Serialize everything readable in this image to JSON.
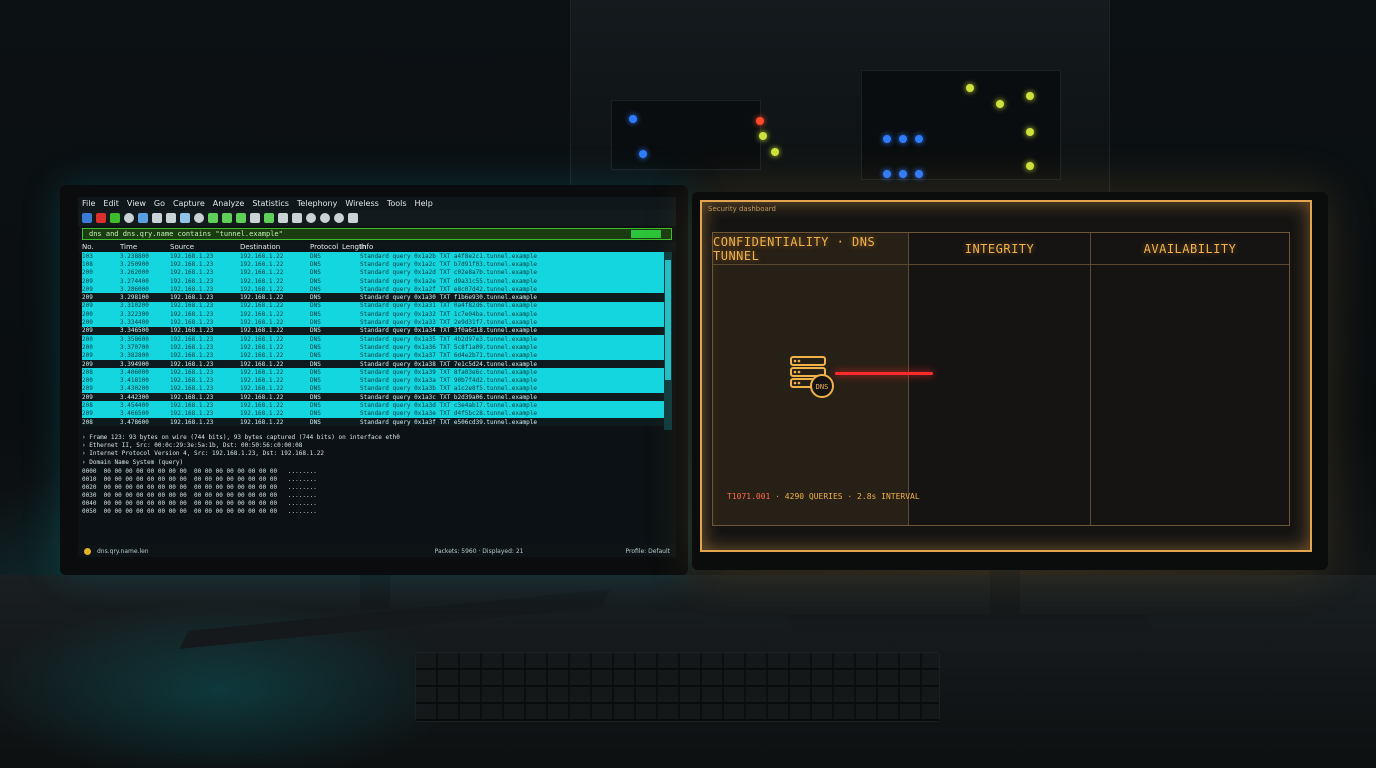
{
  "left_monitor": {
    "menu": [
      "File",
      "Edit",
      "View",
      "Go",
      "Capture",
      "Analyze",
      "Statistics",
      "Telephony",
      "Wireless",
      "Tools",
      "Help"
    ],
    "filter_text": "dns and dns.qry.name contains \"tunnel.example\"",
    "columns": [
      "No.",
      "Time",
      "Source",
      "Destination",
      "Protocol",
      "Length",
      "Info"
    ],
    "packets": [
      {
        "no": "103",
        "time": "3.238800",
        "src": "192.168.1.23",
        "dst": "192.168.1.22",
        "proto": "DNS",
        "info": "Standard query 0x1a2b TXT a4f8e2c1.tunnel.example"
      },
      {
        "no": "108",
        "time": "3.250900",
        "src": "192.168.1.23",
        "dst": "192.168.1.22",
        "proto": "DNS",
        "info": "Standard query 0x1a2c TXT b7d91f03.tunnel.example"
      },
      {
        "no": "200",
        "time": "3.262000",
        "src": "192.168.1.23",
        "dst": "192.168.1.22",
        "proto": "DNS",
        "info": "Standard query 0x1a2d TXT c02e8a7b.tunnel.example"
      },
      {
        "no": "209",
        "time": "3.274400",
        "src": "192.168.1.23",
        "dst": "192.168.1.22",
        "proto": "DNS",
        "info": "Standard query 0x1a2e TXT d9a31c55.tunnel.example"
      },
      {
        "no": "209",
        "time": "3.286000",
        "src": "192.168.1.23",
        "dst": "192.168.1.22",
        "proto": "DNS",
        "info": "Standard query 0x1a2f TXT e8c07d42.tunnel.example"
      },
      {
        "no": "209",
        "time": "3.298100",
        "src": "192.168.1.23",
        "dst": "192.168.1.22",
        "proto": "DNS",
        "info": "Standard query 0x1a30 TXT f1b6e930.tunnel.example"
      },
      {
        "no": "209",
        "time": "3.310200",
        "src": "192.168.1.23",
        "dst": "192.168.1.22",
        "proto": "DNS",
        "info": "Standard query 0x1a31 TXT 0a4f82d6.tunnel.example"
      },
      {
        "no": "200",
        "time": "3.322300",
        "src": "192.168.1.23",
        "dst": "192.168.1.22",
        "proto": "DNS",
        "info": "Standard query 0x1a32 TXT 1c7e04ba.tunnel.example"
      },
      {
        "no": "200",
        "time": "3.334400",
        "src": "192.168.1.23",
        "dst": "192.168.1.22",
        "proto": "DNS",
        "info": "Standard query 0x1a33 TXT 2e9d31f7.tunnel.example"
      },
      {
        "no": "209",
        "time": "3.346500",
        "src": "192.168.1.23",
        "dst": "192.168.1.22",
        "proto": "DNS",
        "info": "Standard query 0x1a34 TXT 3f0a6c18.tunnel.example"
      },
      {
        "no": "200",
        "time": "3.358600",
        "src": "192.168.1.23",
        "dst": "192.168.1.22",
        "proto": "DNS",
        "info": "Standard query 0x1a35 TXT 4b2d97e3.tunnel.example"
      },
      {
        "no": "200",
        "time": "3.370700",
        "src": "192.168.1.23",
        "dst": "192.168.1.22",
        "proto": "DNS",
        "info": "Standard query 0x1a36 TXT 5c8f1a09.tunnel.example"
      },
      {
        "no": "209",
        "time": "3.382800",
        "src": "192.168.1.23",
        "dst": "192.168.1.22",
        "proto": "DNS",
        "info": "Standard query 0x1a37 TXT 6d4e2b71.tunnel.example"
      },
      {
        "no": "209",
        "time": "3.394900",
        "src": "192.168.1.23",
        "dst": "192.168.1.22",
        "proto": "DNS",
        "info": "Standard query 0x1a38 TXT 7e1c5d24.tunnel.example"
      },
      {
        "no": "208",
        "time": "3.406000",
        "src": "192.168.1.23",
        "dst": "192.168.1.22",
        "proto": "DNS",
        "info": "Standard query 0x1a39 TXT 8fa03e6c.tunnel.example"
      },
      {
        "no": "200",
        "time": "3.418100",
        "src": "192.168.1.23",
        "dst": "192.168.1.22",
        "proto": "DNS",
        "info": "Standard query 0x1a3a TXT 90b7f4d2.tunnel.example"
      },
      {
        "no": "209",
        "time": "3.430200",
        "src": "192.168.1.23",
        "dst": "192.168.1.22",
        "proto": "DNS",
        "info": "Standard query 0x1a3b TXT a1c2e8f5.tunnel.example"
      },
      {
        "no": "209",
        "time": "3.442300",
        "src": "192.168.1.23",
        "dst": "192.168.1.22",
        "proto": "DNS",
        "info": "Standard query 0x1a3c TXT b2d39a06.tunnel.example"
      },
      {
        "no": "208",
        "time": "3.454400",
        "src": "192.168.1.23",
        "dst": "192.168.1.22",
        "proto": "DNS",
        "info": "Standard query 0x1a3d TXT c3e4ab17.tunnel.example"
      },
      {
        "no": "209",
        "time": "3.466500",
        "src": "192.168.1.23",
        "dst": "192.168.1.22",
        "proto": "DNS",
        "info": "Standard query 0x1a3e TXT d4f5bc28.tunnel.example"
      },
      {
        "no": "208",
        "time": "3.478600",
        "src": "192.168.1.23",
        "dst": "192.168.1.22",
        "proto": "DNS",
        "info": "Standard query 0x1a3f TXT e506cd39.tunnel.example"
      }
    ],
    "details": [
      "Frame 123: 93 bytes on wire (744 bits), 93 bytes captured (744 bits) on interface eth0",
      "Ethernet II, Src: 00:0c:29:3e:5a:1b, Dst: 00:50:56:c0:00:08",
      "Internet Protocol Version 4, Src: 192.168.1.23, Dst: 192.168.1.22",
      "Domain Name System (query)"
    ],
    "hex": [
      "0000  00 00 00 00 00 00 00 00  00 00 00 00 00 00 00 00   ........",
      "0010  00 00 00 00 00 00 00 00  00 00 00 00 00 00 00 00   ........",
      "0020  00 00 00 00 00 00 00 00  00 00 00 00 00 00 00 00   ........",
      "0030  00 00 00 00 00 00 00 00  00 00 00 00 00 00 00 00   ........",
      "0040  00 00 00 00 00 00 00 00  00 00 00 00 00 00 00 00   ........",
      "0050  00 00 00 00 00 00 00 00  00 00 00 00 00 00 00 00   ........"
    ],
    "status_left": "dns.qry.name.len",
    "status_mid": "Packets: 5960 · Displayed: 21",
    "status_right": "Profile: Default"
  },
  "right_monitor": {
    "window_title": "Security dashboard",
    "columns": [
      "CONFIDENTIALITY · DNS TUNNEL",
      "INTEGRITY",
      "AVAILABILITY"
    ],
    "dns_badge": "DNS",
    "readout_time": "T1071.001",
    "readout_rest": " · 4290 QUERIES · 2.8s INTERVAL"
  },
  "colors": {
    "accent_amber": "#f2b24a",
    "tunnel_red": "#ff2a2a",
    "packet_cyan": "#14d6df",
    "filter_green": "#3dbd2b"
  }
}
